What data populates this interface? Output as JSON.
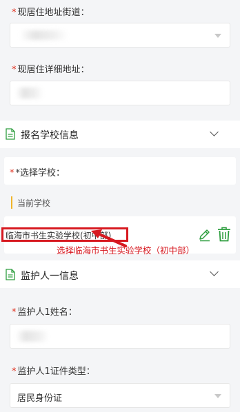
{
  "address": {
    "street_label": "现居住地址街道：",
    "detail_label": "现居住详细地址："
  },
  "school_section": {
    "title": "报名学校信息",
    "select_label": "*选择学校：",
    "current_label": "当前学校",
    "school_name": "临海市书生实验学校(初中部)",
    "annotation": "选择临海市书生实验学校（初中部）"
  },
  "guardian_section": {
    "title": "监护人一信息",
    "name_label": "监护人1姓名：",
    "id_type_label": "监护人1证件类型：",
    "id_type_value": "居民身份证"
  },
  "colors": {
    "required": "#e0301e",
    "accent_green": "#2e9e3f",
    "annotation_red": "#d71920",
    "current_marker": "#f0b429"
  }
}
